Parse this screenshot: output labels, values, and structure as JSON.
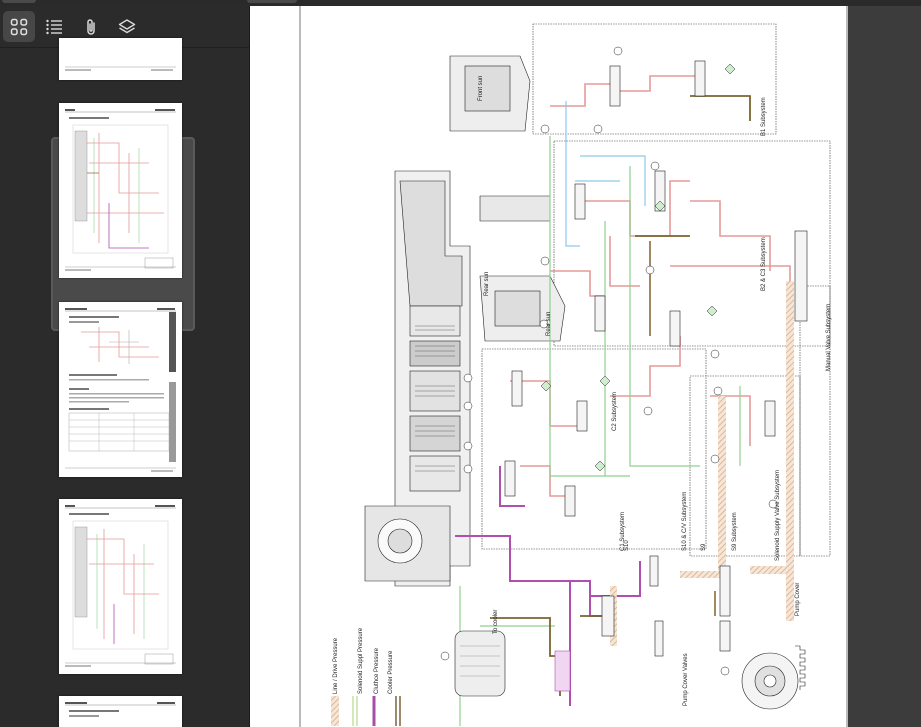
{
  "toolbar": {
    "buttons": [
      {
        "name": "thumbnails-view-button",
        "icon": "grid-icon",
        "active": true
      },
      {
        "name": "outline-view-button",
        "icon": "list-icon",
        "active": false
      },
      {
        "name": "attachments-button",
        "icon": "paperclip-icon",
        "active": false
      },
      {
        "name": "layers-button",
        "icon": "layers-icon",
        "active": false
      }
    ]
  },
  "thumbnails": [
    {
      "page": 1,
      "selected": false
    },
    {
      "page": 2,
      "selected": true
    },
    {
      "page": 3,
      "selected": false
    },
    {
      "page": 4,
      "selected": false
    },
    {
      "page": 5,
      "selected": false
    }
  ],
  "diagram": {
    "subsystems": {
      "b1": "B1 Subsystem",
      "b2_c3": "B2 & C3 Subsystem",
      "manual_valve": "Manual Valve Subsystem",
      "c2": "C2 Subsystem",
      "c1": "C1 Subsystem",
      "s10_cv": "S10 & C/V Subsystem",
      "s9": "S9 Subsystem",
      "solenoid_supply": "Solenoid Supply Valve Subsystem",
      "pump_cover": "Pump Cover",
      "pump_cover_valves": "Pump Cover Valves"
    },
    "labels": {
      "front_sun": "Front sun",
      "rear_sun": "Rear sun",
      "to_cooler": "To cooler",
      "s10": "S10",
      "s9": "S9"
    },
    "legend": [
      {
        "label": "Line / Drive Pressure",
        "color": "#d9a882",
        "style": "hatch"
      },
      {
        "label": "Solenoid Suppl Pressure",
        "color": "#b7d98a",
        "style": "double"
      },
      {
        "label": "Cluthce Pressure",
        "color": "#a64fa6",
        "style": "solid"
      },
      {
        "label": "Cooler Pressure",
        "color": "#6e5a2e",
        "style": "double"
      }
    ],
    "colors": {
      "line_pressure": "#e59a9a",
      "solenoid_supply": "#8fd18f",
      "clutch": "#b04fb0",
      "cooler": "#7a6530",
      "cooling": "#8ec9e8",
      "brown": "#8a6b3a"
    }
  }
}
